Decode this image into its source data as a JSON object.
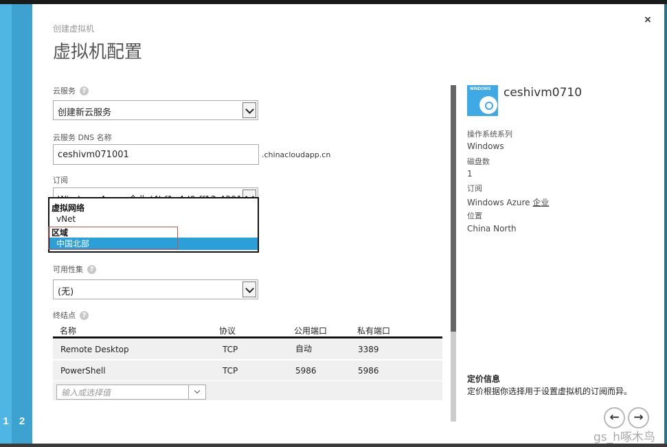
{
  "wizard": {
    "steps": [
      "1",
      "2"
    ],
    "breadcrumb": "创建虚拟机",
    "title": "虚拟机配置",
    "close_label": "×"
  },
  "form": {
    "cloud_service": {
      "label": "云服务",
      "help": "?",
      "value": "创建新云服务"
    },
    "dns_name": {
      "label": "云服务 DNS 名称",
      "value": "ceshivm071001",
      "suffix": ".chinacloudapp.cn"
    },
    "subscription": {
      "label": "订阅",
      "value": "Windows Azure 企业 (4bf1a4d0-ff13-4391-9b5",
      "dropdown": {
        "groups": [
          {
            "label": "虚拟网络",
            "items": [
              {
                "label": "vNet",
                "selected": false
              }
            ]
          },
          {
            "label": "区域",
            "items": [
              {
                "label": "中国北部",
                "selected": true
              }
            ]
          }
        ]
      }
    },
    "availability_set": {
      "label": "可用性集",
      "help": "?",
      "value": "(无)"
    },
    "endpoints": {
      "label": "终结点",
      "help": "?",
      "columns": [
        "名称",
        "协议",
        "公用端口",
        "私有端口"
      ],
      "rows": [
        {
          "name": "Remote Desktop",
          "protocol": "TCP",
          "public_port": "自动",
          "private_port": "3389"
        },
        {
          "name": "PowerShell",
          "protocol": "TCP",
          "public_port": "5986",
          "private_port": "5986"
        }
      ],
      "new_placeholder": "输入或选择值"
    }
  },
  "summary": {
    "icon_text": "WINDOWS",
    "vm_name": "ceshivm0710",
    "fields": [
      {
        "label": "操作系统系列",
        "value": "Windows"
      },
      {
        "label": "磁盘数",
        "value": "1"
      },
      {
        "label": "订阅",
        "value": "Windows Azure ",
        "value_link": "企业"
      },
      {
        "label": "位置",
        "value": "China North"
      }
    ],
    "pricing_title": "定价信息",
    "pricing_text": "定价根据你选择用于设置虚拟机的订阅而异。"
  },
  "nav": {
    "prev": "←",
    "next": "→"
  },
  "watermark": "gs_h啄木鸟",
  "colors": {
    "accent": "#2a9fd8",
    "step1": "#4fb6e3",
    "step2": "#3ea2d0",
    "highlight_box": "#c75050"
  }
}
